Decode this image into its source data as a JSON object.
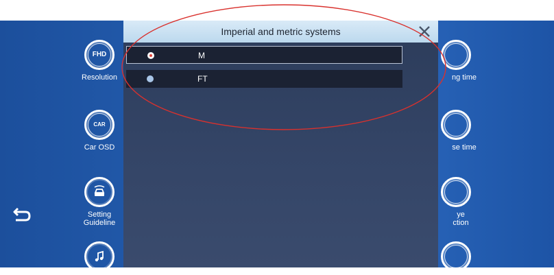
{
  "settings": {
    "left": [
      {
        "badge": "FHD",
        "label": "Resolution",
        "icon": "fhd-icon"
      },
      {
        "badge": "CAR",
        "label": "Car OSD",
        "icon": "car-icon"
      },
      {
        "badge": "",
        "label_line1": "Setting",
        "label_line2": "Guideline",
        "icon": "guideline-icon"
      },
      {
        "badge": "",
        "label": "",
        "icon": "music-icon"
      }
    ],
    "right": [
      {
        "label": "ng time",
        "icon": "recording-time-icon"
      },
      {
        "label": "se time",
        "icon": "lapse-time-icon"
      },
      {
        "label_line1": "ye",
        "label_line2": "ction",
        "icon": "eye-protection-icon"
      },
      {
        "label": "",
        "icon": "clock-icon"
      }
    ]
  },
  "dialog": {
    "title": "Imperial and metric systems",
    "close_icon": "close-icon",
    "options": [
      {
        "label": "M",
        "selected": true
      },
      {
        "label": "FT",
        "selected": false
      }
    ]
  },
  "colors": {
    "background": "#2560b3",
    "dialog": "#344567",
    "header": "#c9e1f2",
    "annotation": "#d9312d"
  }
}
